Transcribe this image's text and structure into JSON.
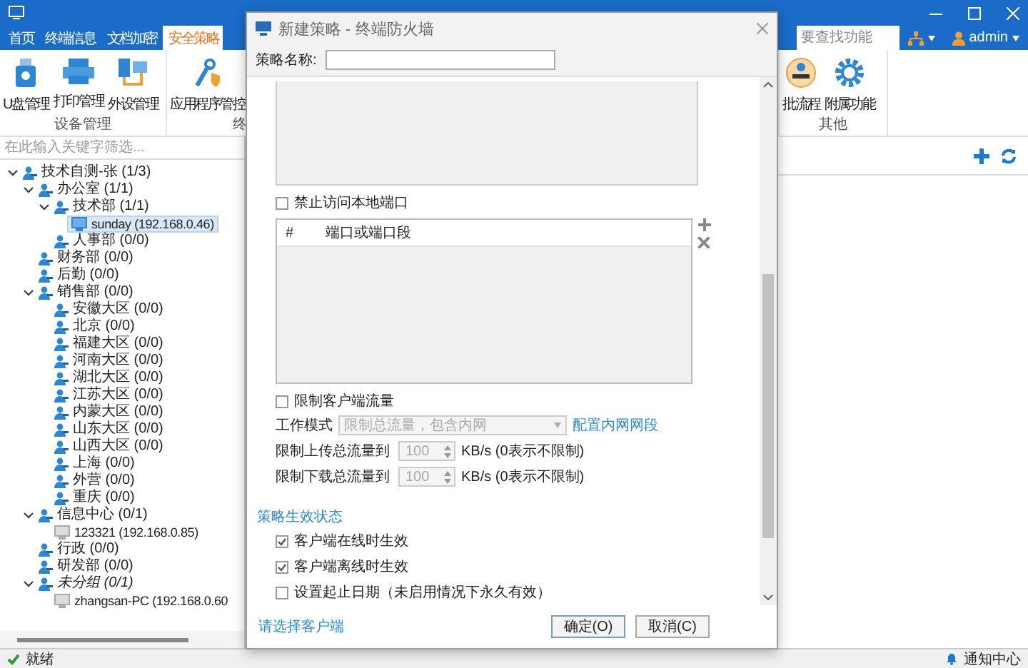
{
  "tabs": [
    {
      "label": "首页",
      "selected": false
    },
    {
      "label": "终端信息",
      "selected": false
    },
    {
      "label": "文档加密",
      "selected": false
    },
    {
      "label": "安全策略",
      "selected": true
    }
  ],
  "search": {
    "placeholder": "要查找功能"
  },
  "user": {
    "name": "admin"
  },
  "ribbon": {
    "groups": [
      {
        "label": "设备管理",
        "items": [
          {
            "label": "U盘管理",
            "kind": "usb"
          },
          {
            "label": "打印管理",
            "kind": "printer"
          },
          {
            "label": "外设管理",
            "kind": "peripheral"
          }
        ]
      },
      {
        "label": "终",
        "items": [
          {
            "label": "应用程序管控",
            "kind": "app"
          }
        ]
      },
      {
        "label": "其他",
        "items": [
          {
            "label": "批流程",
            "kind": "approval"
          },
          {
            "label": "附属功能",
            "kind": "addon"
          }
        ]
      }
    ]
  },
  "tree": {
    "filter_placeholder": "在此输入关键字筛选...",
    "items": [
      {
        "label": "技术自测-张 (1/3)",
        "kind": "group",
        "expanded": true,
        "selected": false,
        "children": [
          {
            "label": "办公室 (1/1)",
            "kind": "group",
            "expanded": true,
            "selected": false,
            "children": [
              {
                "label": "技术部 (1/1)",
                "kind": "group",
                "expanded": true,
                "selected": false,
                "children": [
                  {
                    "label": "sunday (192.168.0.46)",
                    "kind": "computer",
                    "online": true,
                    "selected": true
                  }
                ]
              },
              {
                "label": "人事部 (0/0)",
                "kind": "group",
                "selected": false
              }
            ]
          },
          {
            "label": "财务部 (0/0)",
            "kind": "group",
            "selected": false
          },
          {
            "label": "后勤 (0/0)",
            "kind": "group",
            "selected": false
          },
          {
            "label": "销售部 (0/0)",
            "kind": "group",
            "expanded": true,
            "selected": false,
            "children": [
              {
                "label": "安徽大区 (0/0)",
                "kind": "group",
                "selected": false
              },
              {
                "label": "北京 (0/0)",
                "kind": "group",
                "selected": false
              },
              {
                "label": "福建大区 (0/0)",
                "kind": "group",
                "selected": false
              },
              {
                "label": "河南大区 (0/0)",
                "kind": "group",
                "selected": false
              },
              {
                "label": "湖北大区 (0/0)",
                "kind": "group",
                "selected": false
              },
              {
                "label": "江苏大区 (0/0)",
                "kind": "group",
                "selected": false
              },
              {
                "label": "内蒙大区 (0/0)",
                "kind": "group",
                "selected": false
              },
              {
                "label": "山东大区 (0/0)",
                "kind": "group",
                "selected": false
              },
              {
                "label": "山西大区 (0/0)",
                "kind": "group",
                "selected": false
              },
              {
                "label": "上海 (0/0)",
                "kind": "group",
                "selected": false
              },
              {
                "label": "外营 (0/0)",
                "kind": "group",
                "selected": false
              },
              {
                "label": "重庆 (0/0)",
                "kind": "group",
                "selected": false
              }
            ]
          },
          {
            "label": "信息中心 (0/1)",
            "kind": "group",
            "expanded": true,
            "selected": false,
            "children": [
              {
                "label": "123321 (192.168.0.85)",
                "kind": "computer",
                "online": false,
                "selected": false
              }
            ]
          },
          {
            "label": "行政 (0/0)",
            "kind": "group",
            "selected": false
          },
          {
            "label": "研发部 (0/0)",
            "kind": "group",
            "selected": false
          },
          {
            "label": "未分组 (0/1)",
            "kind": "ungrouped",
            "expanded": true,
            "selected": false,
            "children": [
              {
                "label": "zhangsan-PC (192.168.0.60",
                "kind": "computer",
                "online": false,
                "selected": false
              }
            ]
          }
        ]
      }
    ]
  },
  "dialog": {
    "title": "新建策略 - 终端防火墙",
    "name_label": "策略名称:",
    "block_local_ports": {
      "label": "禁止访问本地端口",
      "checked": false
    },
    "ports_table": {
      "columns": [
        "#",
        "端口或端口段"
      ]
    },
    "limit_traffic": {
      "label": "限制客户端流量",
      "checked": false
    },
    "work_mode": {
      "label": "工作模式",
      "value": "限制总流量，包含内网",
      "disabled": true,
      "link": "配置内网网段"
    },
    "limits": [
      {
        "label": "限制上传总流量到",
        "value": "100",
        "disabled": true,
        "unit_hint": "KB/s (0表示不限制)"
      },
      {
        "label": "限制下载总流量到",
        "value": "100",
        "disabled": true,
        "unit_hint": "KB/s (0表示不限制)"
      }
    ],
    "effect_section": {
      "title": "策略生效状态",
      "options": [
        {
          "label": "客户端在线时生效",
          "checked": true
        },
        {
          "label": "客户端离线时生效",
          "checked": true
        },
        {
          "label": "设置起止日期（未启用情况下永久有效）",
          "checked": false
        }
      ]
    },
    "footer_link": "请选择客户端",
    "buttons": [
      {
        "label": "确定(O)"
      },
      {
        "label": "取消(C)"
      }
    ]
  },
  "status_bar": {
    "status": "就绪",
    "notification": "通知中心"
  }
}
